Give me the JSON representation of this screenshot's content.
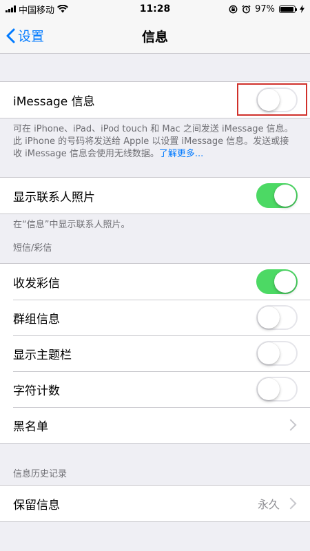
{
  "status_bar": {
    "carrier": "中国移动",
    "time": "11:28",
    "battery": "97%",
    "battery_level": 0.97
  },
  "nav": {
    "back_label": "设置",
    "title": "信息"
  },
  "imessage": {
    "label": "iMessage 信息",
    "on": false,
    "footer": "可在 iPhone、iPad、iPod touch 和 Mac 之间发送 iMessage 信息。此 iPhone 的号码将发送给 Apple 以设置 iMessage 信息。发送或接收 iMessage 信息会使用无线数据。",
    "learn_more": "了解更多..."
  },
  "contact_photos": {
    "label": "显示联系人照片",
    "on": true,
    "footer": "在“信息”中显示联系人照片。"
  },
  "sms_mms": {
    "header": "短信/彩信",
    "items": [
      {
        "label": "收发彩信",
        "on": true
      },
      {
        "label": "群组信息",
        "on": false
      },
      {
        "label": "显示主题栏",
        "on": false
      },
      {
        "label": "字符计数",
        "on": false
      },
      {
        "label": "黑名单"
      }
    ]
  },
  "history": {
    "header": "信息历史记录",
    "keep_label": "保留信息",
    "keep_value": "永久"
  },
  "colors": {
    "accent": "#007aff",
    "toggle_on": "#4cd964",
    "highlight": "#d0302a"
  }
}
